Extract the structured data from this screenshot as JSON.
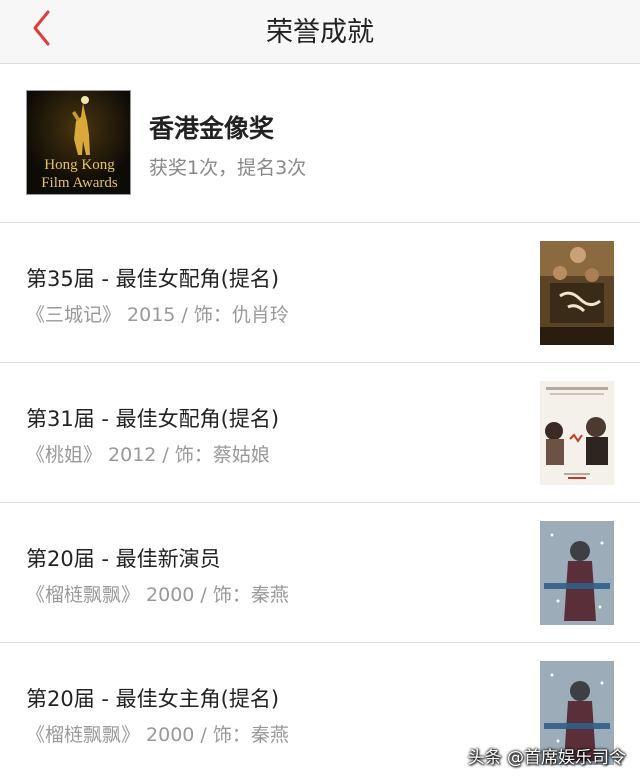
{
  "navbar": {
    "title": "荣誉成就",
    "back_icon": "chevron-left-icon",
    "accent_color": "#e23b3b"
  },
  "award": {
    "name": "香港金像奖",
    "stats": "获奖1次，提名3次",
    "logo_text_line1": "Hong Kong",
    "logo_text_line2": "Film Awards"
  },
  "entries": [
    {
      "title": "第35届 - 最佳女配角(提名)",
      "subtitle": "《三城记》 2015 / 饰：仇肖玲"
    },
    {
      "title": "第31届 - 最佳女配角(提名)",
      "subtitle": "《桃姐》 2012 / 饰：蔡姑娘"
    },
    {
      "title": "第20届 - 最佳新演员",
      "subtitle": "《榴梿飘飘》 2000 / 饰：秦燕"
    },
    {
      "title": "第20届 - 最佳女主角(提名)",
      "subtitle": "《榴梿飘飘》 2000 / 饰：秦燕"
    }
  ],
  "watermark": "头条 @首席娱乐司令"
}
